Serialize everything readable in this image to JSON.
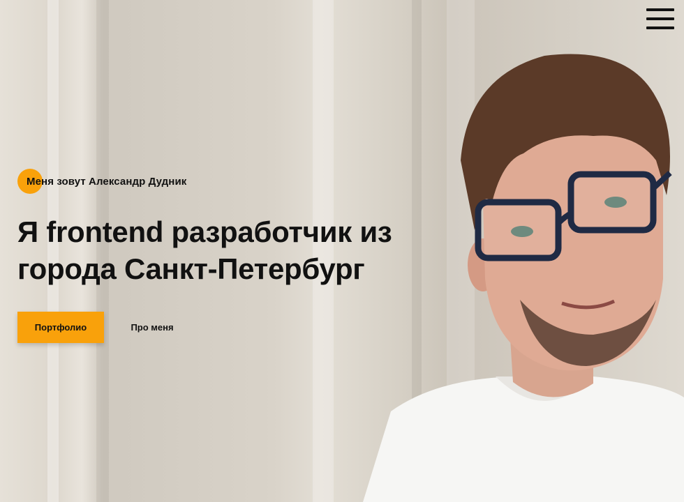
{
  "header": {
    "menu_icon": "hamburger-menu-icon"
  },
  "hero": {
    "intro": "Меня зовут Александр Дудник",
    "headline": "Я frontend разработчик из города Санкт-Петербург",
    "portfolio_button": "Портфолио",
    "about_button": "Про меня",
    "accent_color": "#f9a10b"
  }
}
